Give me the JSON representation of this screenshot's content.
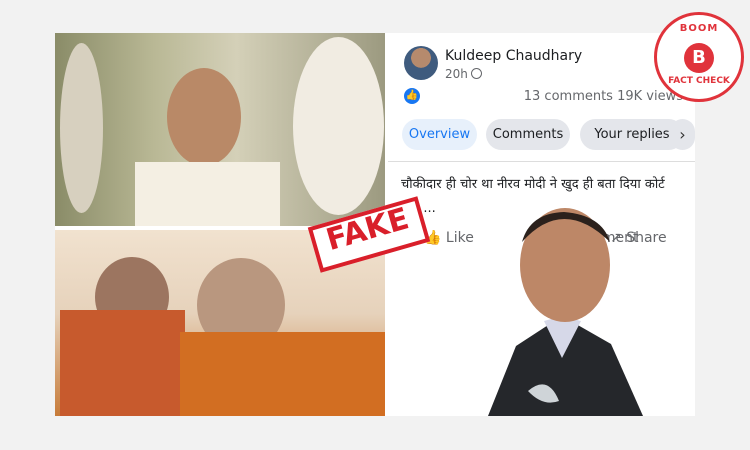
{
  "post": {
    "author": "Kuldeep Chaudhary",
    "time": "20h",
    "stats": "13 comments  19K views",
    "tabs": [
      "Overview",
      "Comments",
      "Your replies"
    ],
    "text": "चौकीदार ही चोर था नीरव मोदी ने खुद ही बता दिया कोर्ट को। ...",
    "actions": {
      "like": "Like",
      "comment": "Comment",
      "share": "Share"
    }
  },
  "stamp": {
    "fake": "FAKE"
  },
  "logo": {
    "top": "BOOM",
    "letter": "B",
    "bottom": "FACT CHECK"
  },
  "colors": {
    "accent": "#1877f2",
    "brand": "#e0333b"
  },
  "icons": [
    "globe-icon",
    "like-icon",
    "comment-icon",
    "share-icon",
    "chevron-right-icon"
  ]
}
